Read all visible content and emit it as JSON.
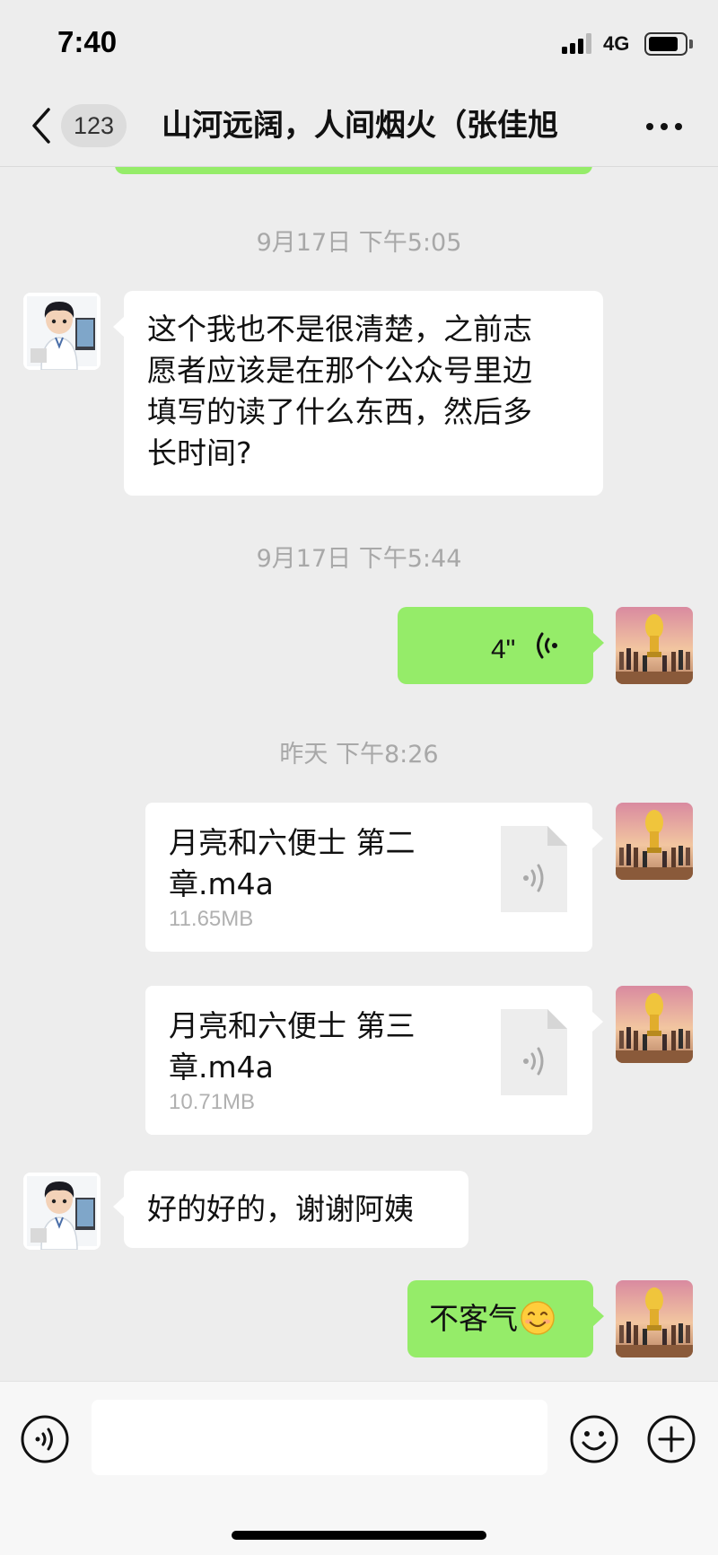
{
  "status_bar": {
    "time": "7:40",
    "network": "4G",
    "battery_level": 0.85,
    "signal_bars": 3
  },
  "header": {
    "back_icon": "chevron-left-icon",
    "unread_count": "123",
    "title": "山河远阔，人间烟火（张佳旭",
    "more_icon": "more-dots-icon"
  },
  "colors": {
    "background": "#ededed",
    "my_bubble": "#95ec69",
    "their_bubble": "#ffffff",
    "timestamp": "#a8a8a8"
  },
  "messages": [
    {
      "type": "timestamp",
      "text": "9月17日 下午5:05"
    },
    {
      "type": "text",
      "sender": "other",
      "avatar": "boy-at-computer-avatar",
      "lines": [
        "这个我也不是很清楚，之前志",
        "愿者应该是在那个公众号里边",
        "填写的读了什么东西，然后多",
        "长时间?"
      ]
    },
    {
      "type": "timestamp",
      "text": "9月17日 下午5:44"
    },
    {
      "type": "voice",
      "sender": "self",
      "avatar": "golden-trophy-avatar",
      "duration": "4\""
    },
    {
      "type": "timestamp",
      "text": "昨天 下午8:26"
    },
    {
      "type": "file",
      "sender": "self",
      "avatar": "golden-trophy-avatar",
      "name_lines": [
        "月亮和六便士 第二",
        "章.m4a"
      ],
      "size": "11.65MB",
      "icon": "audio-file-icon"
    },
    {
      "type": "file",
      "sender": "self",
      "avatar": "golden-trophy-avatar",
      "name_lines": [
        "月亮和六便士 第三",
        "章.m4a"
      ],
      "size": "10.71MB",
      "icon": "audio-file-icon"
    },
    {
      "type": "text",
      "sender": "other",
      "avatar": "boy-at-computer-avatar",
      "lines": [
        "好的好的，谢谢阿姨"
      ]
    },
    {
      "type": "text",
      "sender": "self",
      "avatar": "golden-trophy-avatar",
      "lines": [
        "不客气"
      ],
      "emoji": "smiling-face-emoji"
    }
  ],
  "input_bar": {
    "voice_icon": "voice-input-icon",
    "placeholder": "",
    "emoji_icon": "emoji-icon",
    "plus_icon": "plus-circle-icon"
  }
}
